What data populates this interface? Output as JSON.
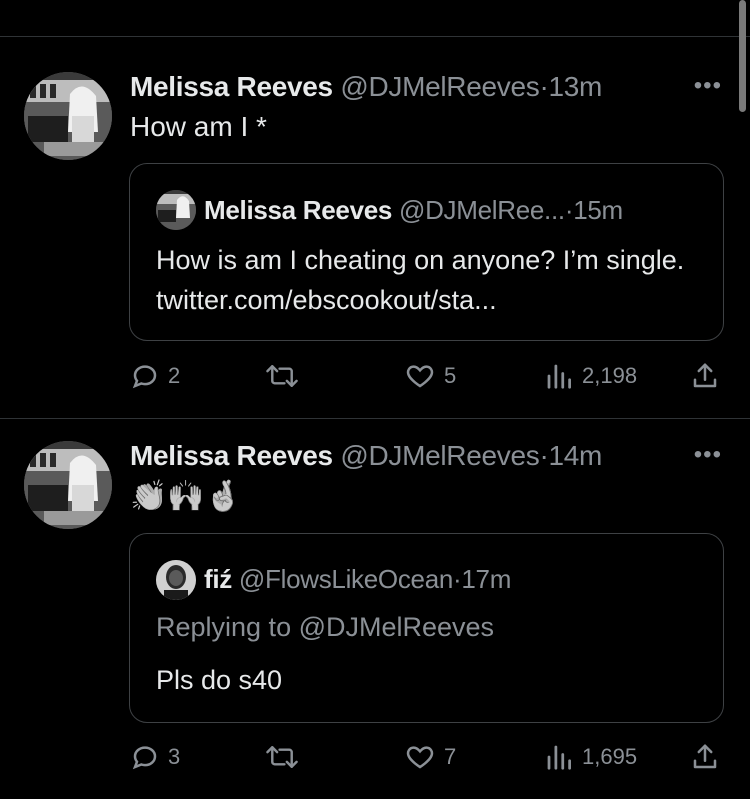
{
  "tweets": [
    {
      "author_name": "Melissa Reeves",
      "handle": "@DJMelReeves",
      "separator": "·",
      "time": "13m",
      "more_label": "•••",
      "text": "How am I *",
      "quote": {
        "author_name": "Melissa Reeves",
        "handle": "@DJMelRee...",
        "separator": "·",
        "time": "15m",
        "body": "How is am I cheating on anyone? I’m single. twitter.com/ebscookout/sta..."
      },
      "stats": {
        "replies": "2",
        "retweets": "",
        "likes": "5",
        "views": "2,198"
      }
    },
    {
      "author_name": "Melissa Reeves",
      "handle": "@DJMelReeves",
      "separator": "·",
      "time": "14m",
      "more_label": "•••",
      "emoji": "👏🙌🤞",
      "quote": {
        "author_name": "fiź",
        "handle": "@FlowsLikeOcean",
        "separator": "·",
        "time": "17m",
        "replying_to": "Replying to @DJMelReeves",
        "body": "Pls do s40"
      },
      "stats": {
        "replies": "3",
        "retweets": "",
        "likes": "7",
        "views": "1,695"
      }
    }
  ],
  "icons": {
    "reply": "reply-icon",
    "retweet": "retweet-icon",
    "like": "heart-icon",
    "views": "views-icon",
    "share": "share-icon"
  },
  "colors": {
    "background": "#000000",
    "text": "#e7e9ea",
    "muted": "#8b9096",
    "border": "#2f3336"
  }
}
